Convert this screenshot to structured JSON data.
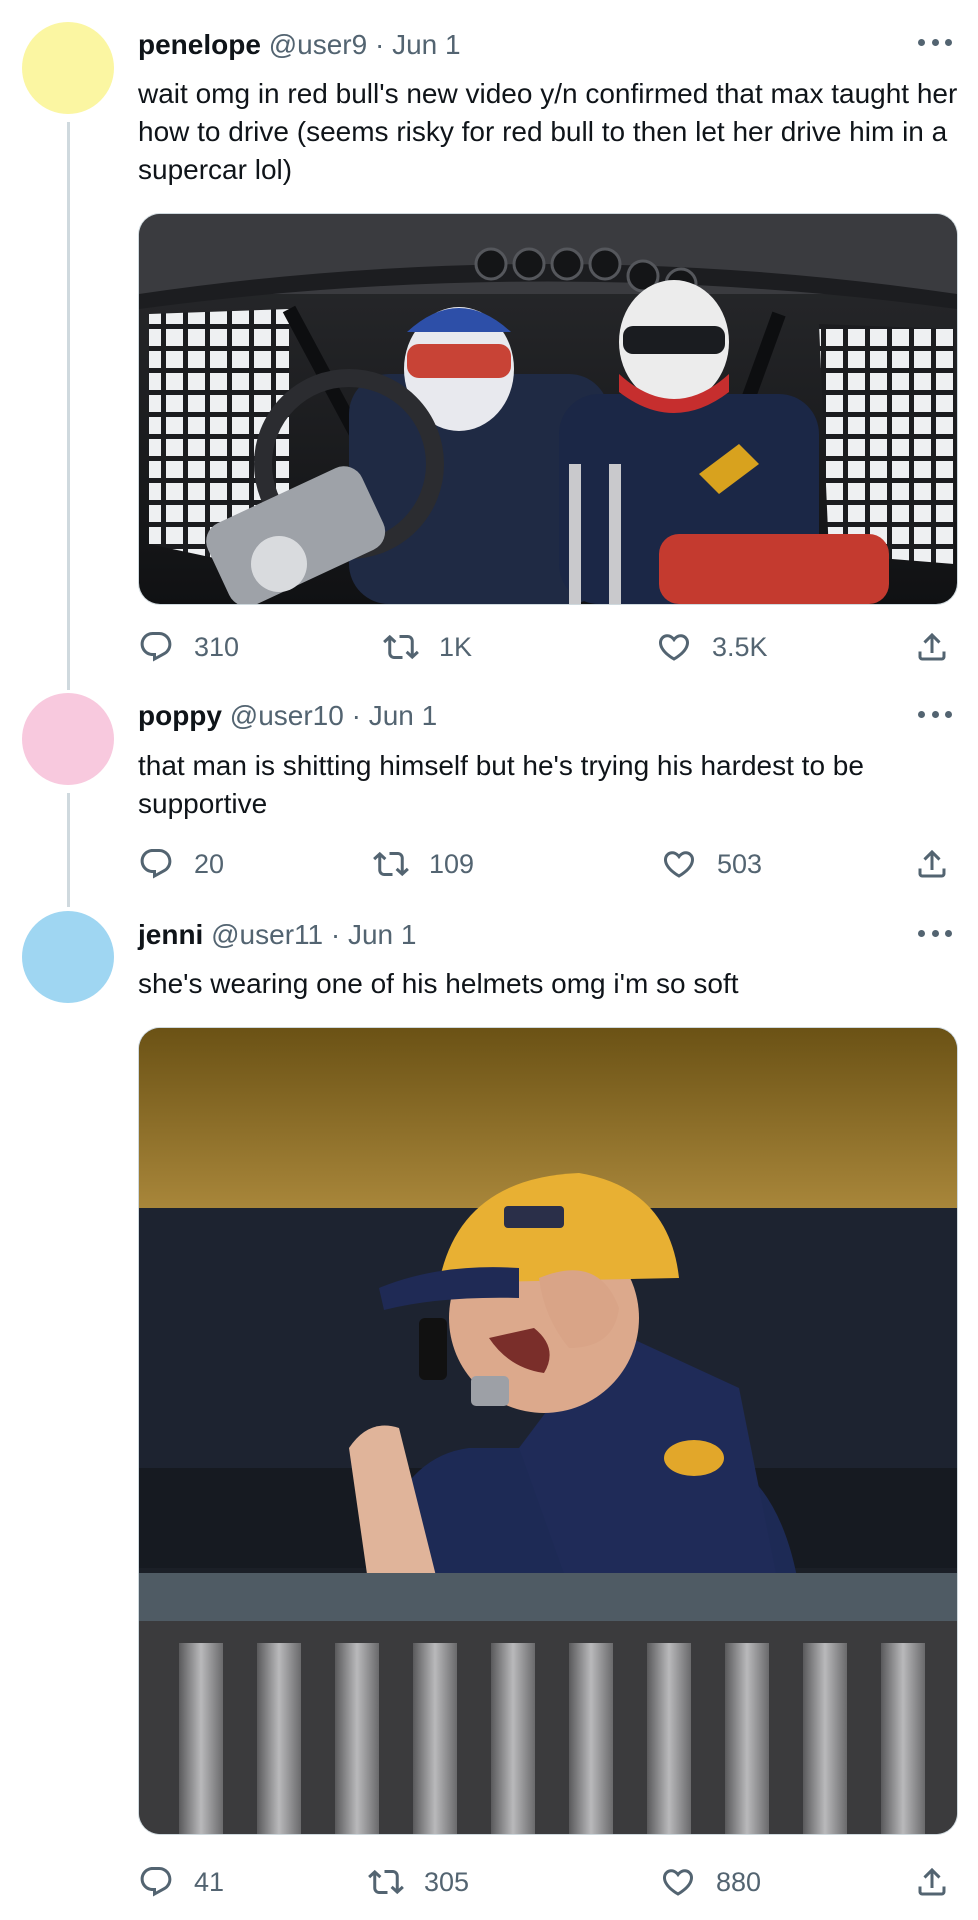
{
  "tweets": [
    {
      "name": "penelope",
      "handle": "@user9",
      "date": "Jun 1",
      "avatar_color": "#fbf6a2",
      "text": "wait omg in red bull's new video y/n confirmed that max taught her how to drive (seems risky for red bull to then let her drive him in a supercar lol)",
      "media": "photo: two drivers in helmets seated inside a race car cockpit",
      "stats": {
        "replies": "310",
        "retweets": "1K",
        "likes": "3.5K"
      }
    },
    {
      "name": "poppy",
      "handle": "@user10",
      "date": "Jun 1",
      "avatar_color": "#f8c9de",
      "text": "that man is shitting himself but he's trying his hardest to be supportive",
      "stats": {
        "replies": "20",
        "retweets": "109",
        "likes": "503"
      }
    },
    {
      "name": "jenni",
      "handle": "@user11",
      "date": "Jun 1",
      "avatar_color": "#9fd6f2",
      "text": "she's wearing one of his helmets omg i'm so soft",
      "media": "photo: man in yellow cap and navy team shirt shouting into a phone on a balcony",
      "stats": {
        "replies": "41",
        "retweets": "305",
        "likes": "880"
      }
    }
  ],
  "icons": [
    "more-icon",
    "reply-icon",
    "retweet-icon",
    "like-icon",
    "share-icon"
  ],
  "colors": {
    "text": "#0f1419",
    "secondary": "#536471",
    "thread_line": "#cfd9de"
  }
}
